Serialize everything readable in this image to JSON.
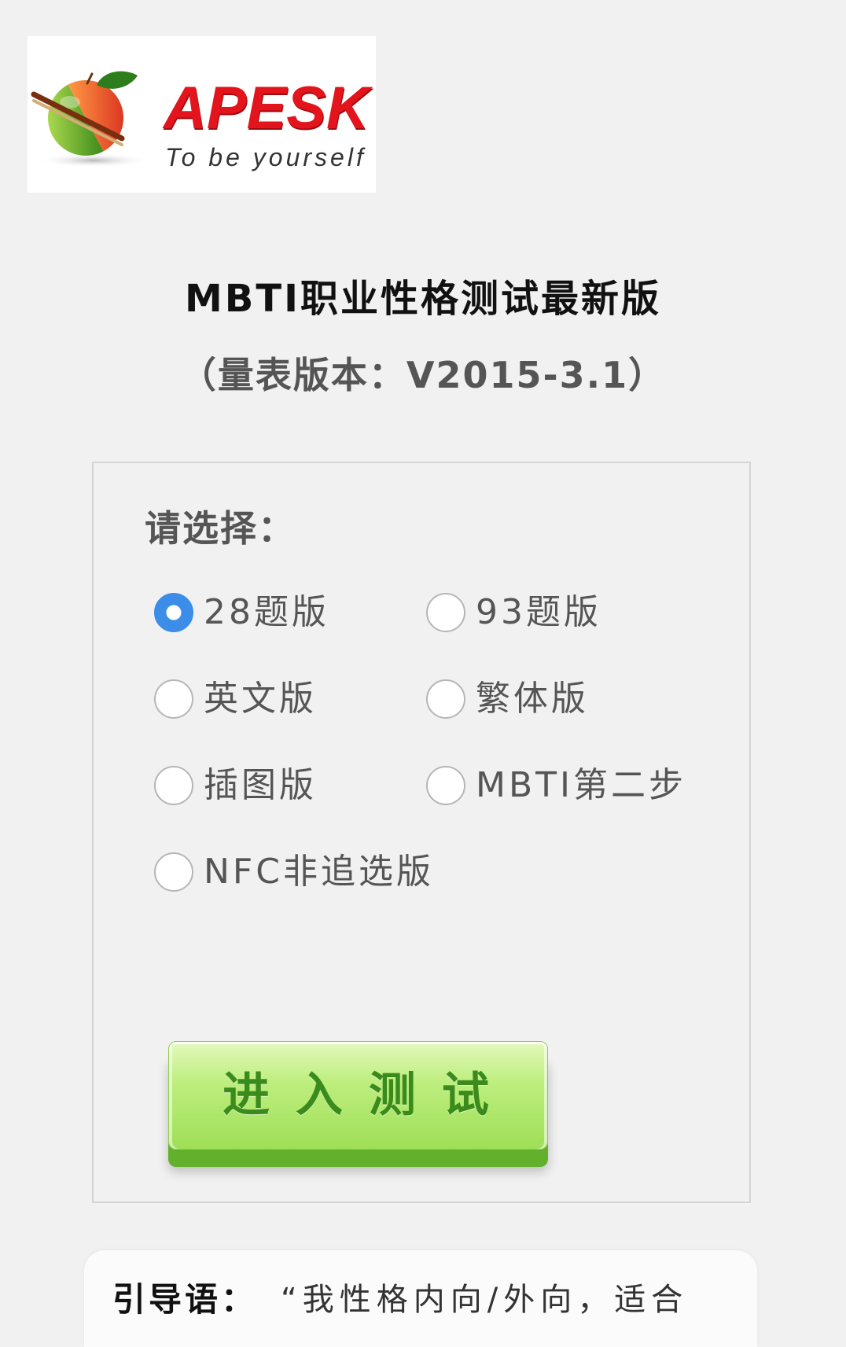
{
  "logo": {
    "brand": "APESK",
    "tagline": "To be yourself",
    "icon": "apple-icon"
  },
  "header": {
    "title": "MBTI职业性格测试最新版",
    "subtitle": "（量表版本：V2015-3.1）"
  },
  "form": {
    "prompt": "请选择：",
    "options": [
      {
        "label": "28题版",
        "checked": true
      },
      {
        "label": "93题版",
        "checked": false
      },
      {
        "label": "英文版",
        "checked": false
      },
      {
        "label": "繁体版",
        "checked": false
      },
      {
        "label": "插图版",
        "checked": false
      },
      {
        "label": "MBTI第二步",
        "checked": false
      },
      {
        "label": "NFC非追选版",
        "checked": false
      }
    ],
    "submit_label": "进 入 测 试"
  },
  "intro": {
    "label": "引导语：",
    "text": "“我性格内向/外向，适合"
  },
  "colors": {
    "page_background": "#f1f1f1",
    "radio_selected": "#3b8de8",
    "button_green": "#9fdf58",
    "button_text": "#3a8a1c",
    "brand_red": "#e3141b"
  }
}
